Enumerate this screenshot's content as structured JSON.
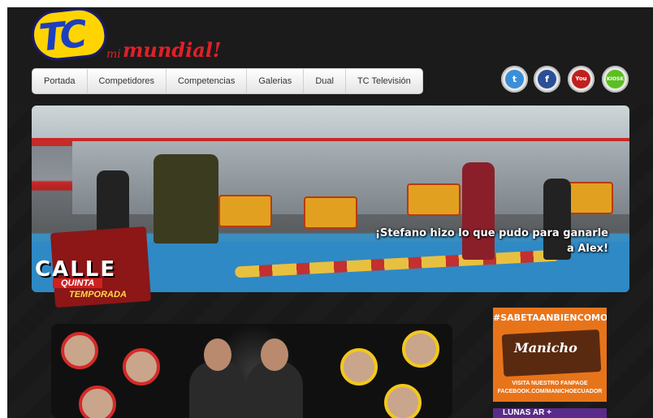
{
  "header": {
    "logo_main": "TC",
    "logo_mi": "mi",
    "logo_mundial": "mundial!"
  },
  "nav": {
    "items": [
      "Portada",
      "Competidores",
      "Competencias",
      "Galerias",
      "Dual",
      "TC Televisión"
    ]
  },
  "social": {
    "items": [
      {
        "name": "twitter-icon",
        "glyph": "🐦",
        "color": "#3a8fd8"
      },
      {
        "name": "facebook-icon",
        "glyph": "f",
        "color": "#2b4f97"
      },
      {
        "name": "youtube-icon",
        "glyph": "You",
        "color": "#c21e1e"
      },
      {
        "name": "kiosk-icon",
        "glyph": "KIOSK",
        "color": "#5bbf1f"
      }
    ]
  },
  "slider": {
    "caption": "¡Stefano hizo lo que pudo para ganarle a Alex!",
    "sign_text": "CALLE"
  },
  "badge": {
    "word": "CALLE",
    "quinta": "QUINTA",
    "temporada": "TEMPORADA"
  },
  "ad": {
    "hashtag": "#SABETAANBIENCOMO",
    "brand": "Manicho",
    "line1": "VISITA NUESTRO FANPAGE",
    "line2": "FACEBOOK.COM/MANICHOECUADOR"
  },
  "ad2": {
    "text": "LUNAS AR +"
  }
}
